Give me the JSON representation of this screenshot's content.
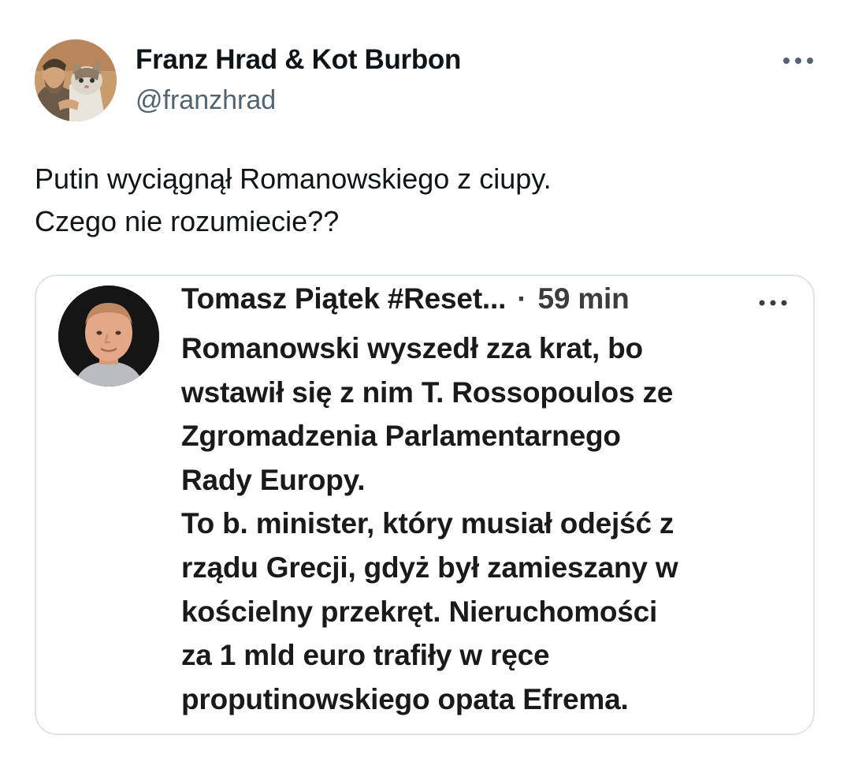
{
  "author": {
    "display_name": "Franz Hrad & Kot Burbon",
    "handle": "@franzhrad",
    "avatar_icon": "avatar-man-with-cat"
  },
  "more_icon": "ellipsis-icon",
  "tweet": {
    "lines": [
      "Putin wyciągnął Romanowskiego z ciupy.",
      "Czego nie rozumiecie??"
    ]
  },
  "embedded_post": {
    "author_name": "Tomasz Piątek #Reset...",
    "separator": "·",
    "timestamp": "59 min",
    "more_icon": "ellipsis-icon",
    "avatar_icon": "avatar-portrait",
    "body_lines": [
      "Romanowski wyszedł zza krat, bo",
      "wstawił się z nim T. Rossopoulos ze",
      "Zgromadzenia Parlamentarnego",
      "Rady Europy.",
      "To b. minister, który musiał odejść z",
      "rządu Grecji, gdyż był zamieszany w",
      "kościelny przekręt. Nieruchomości",
      "za 1 mld euro trafiły w ręce",
      "proputinowskiego opata Efrema."
    ]
  },
  "colors": {
    "text_primary": "#0f1419",
    "text_secondary": "#536471",
    "card_border": "#dfe4e8"
  }
}
